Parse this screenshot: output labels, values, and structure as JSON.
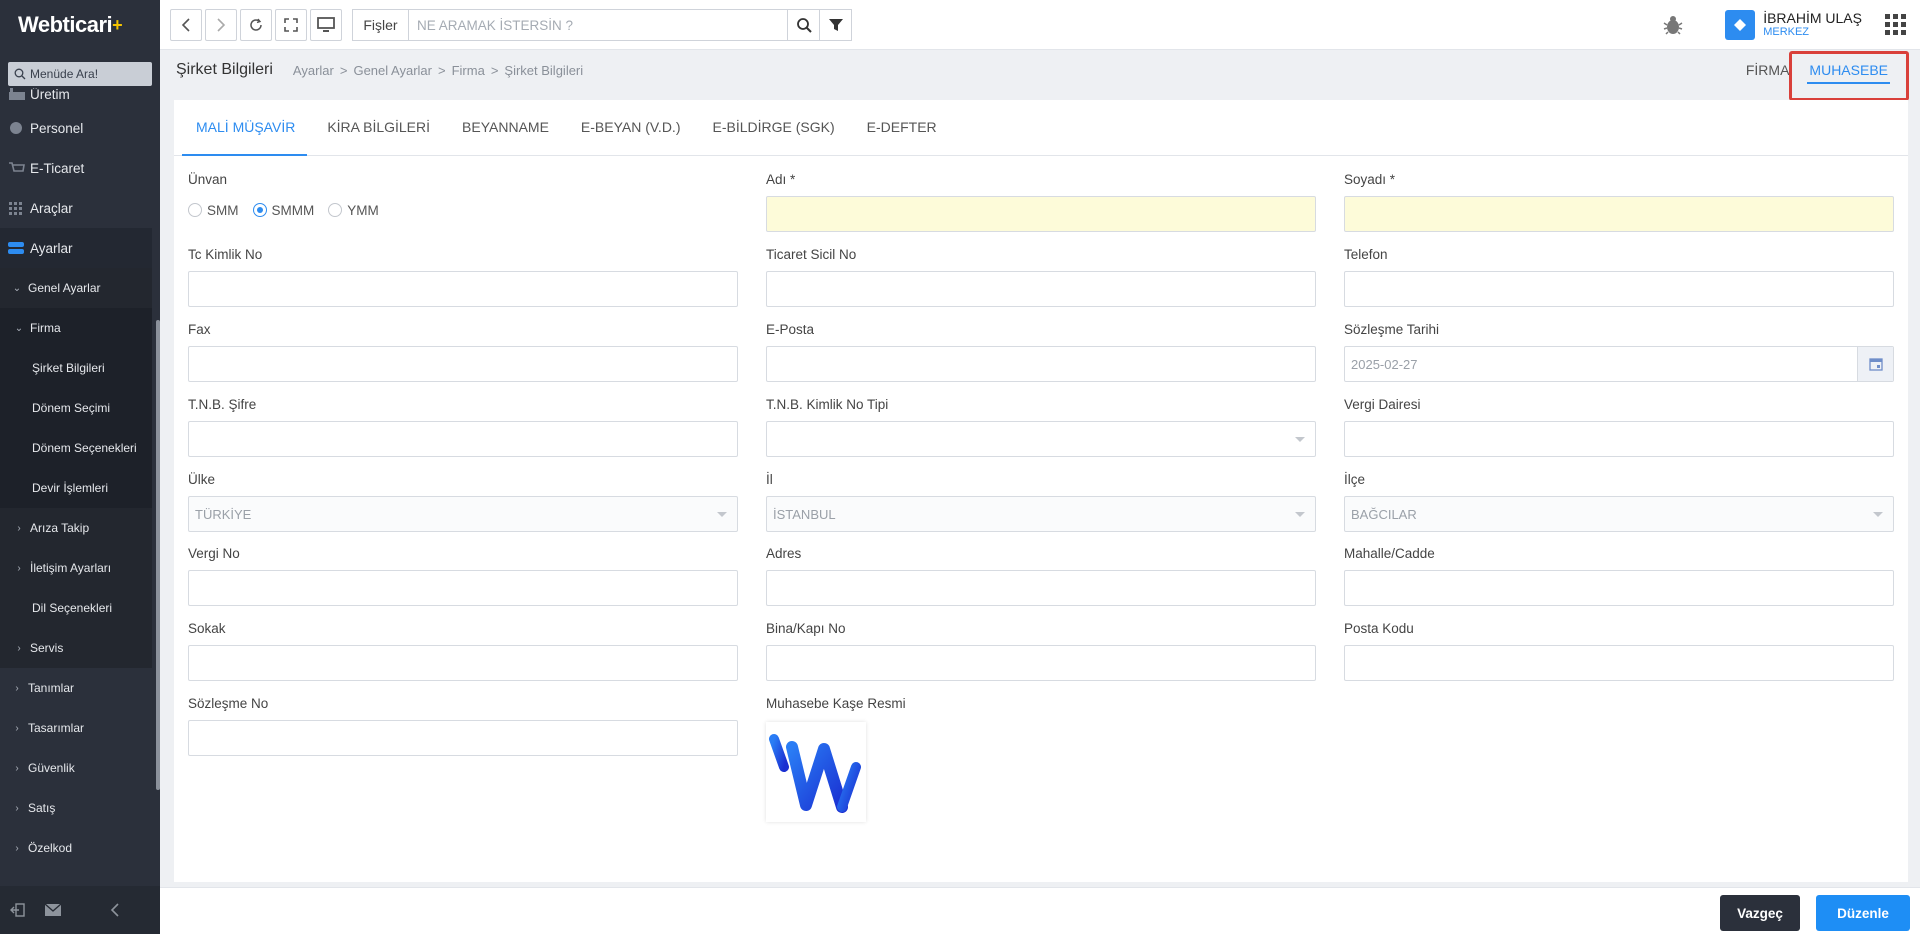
{
  "app": {
    "logo_text": "Webticari",
    "logo_plus": "+"
  },
  "sidebar": {
    "search_placeholder": "Menüde Ara!",
    "top_items": [
      {
        "label": "Üretim",
        "icon": "factory-icon"
      },
      {
        "label": "Personel",
        "icon": "user-icon"
      },
      {
        "label": "E-Ticaret",
        "icon": "cart-icon"
      },
      {
        "label": "Araçlar",
        "icon": "grid-icon"
      },
      {
        "label": "Ayarlar",
        "icon": "toggle-icon"
      }
    ],
    "genel_ayarlar": "Genel Ayarlar",
    "firma": "Firma",
    "firma_children": [
      "Şirket Bilgileri",
      "Dönem Seçimi",
      "Dönem Seçenekleri",
      "Devir İşlemleri"
    ],
    "genel_children": [
      "Arıza Takip",
      "İletişim Ayarları",
      "Dil Seçenekleri",
      "Servis"
    ],
    "root_rest": [
      "Tanımlar",
      "Tasarımlar",
      "Güvenlik",
      "Satış",
      "Özelkod"
    ]
  },
  "topbar": {
    "search_label": "Fişler",
    "search_placeholder": "NE ARAMAK İSTERSİN ?",
    "user_name": "İBRAHİM ULAŞ",
    "user_branch": "MERKEZ"
  },
  "breadcrumb": {
    "title": "Şirket Bilgileri",
    "items": [
      "Ayarlar",
      "Genel Ayarlar",
      "Firma",
      "Şirket Bilgileri"
    ],
    "separator": ">"
  },
  "top_tabs": [
    "FİRMA",
    "MUHASEBE"
  ],
  "tabs": [
    "MALİ MÜŞAVİR",
    "KİRA BİLGİLERİ",
    "BEYANNAME",
    "E-BEYAN (V.D.)",
    "E-BİLDİRGE (SGK)",
    "E-DEFTER"
  ],
  "form": {
    "unvan_label": "Ünvan",
    "unvan_options": [
      "SMM",
      "SMMM",
      "YMM"
    ],
    "unvan_selected": "SMMM",
    "adi_label": "Adı *",
    "soyadi_label": "Soyadı *",
    "tc_label": "Tc Kimlik No",
    "sicil_label": "Ticaret Sicil No",
    "telefon_label": "Telefon",
    "fax_label": "Fax",
    "eposta_label": "E-Posta",
    "sozlesme_tarihi_label": "Sözleşme Tarihi",
    "sozlesme_tarihi_value": "2025-02-27",
    "tnb_sifre_label": "T.N.B. Şifre",
    "tnb_kimlik_label": "T.N.B. Kimlik No Tipi",
    "vergi_dairesi_label": "Vergi Dairesi",
    "ulke_label": "Ülke",
    "ulke_value": "TÜRKİYE",
    "il_label": "İl",
    "il_value": "İSTANBUL",
    "ilce_label": "İlçe",
    "ilce_value": "BAĞCILAR",
    "vergi_no_label": "Vergi No",
    "adres_label": "Adres",
    "mahalle_label": "Mahalle/Cadde",
    "sokak_label": "Sokak",
    "bina_label": "Bina/Kapı No",
    "posta_label": "Posta Kodu",
    "sozlesme_no_label": "Sözleşme No",
    "kase_label": "Muhasebe Kaşe Resmi"
  },
  "footer": {
    "cancel": "Vazgeç",
    "edit": "Düzenle"
  },
  "colors": {
    "accent": "#2d8cf0",
    "sidebar": "#2b303b",
    "required_bg": "#fdfbd9",
    "highlight": "#d9403a"
  }
}
